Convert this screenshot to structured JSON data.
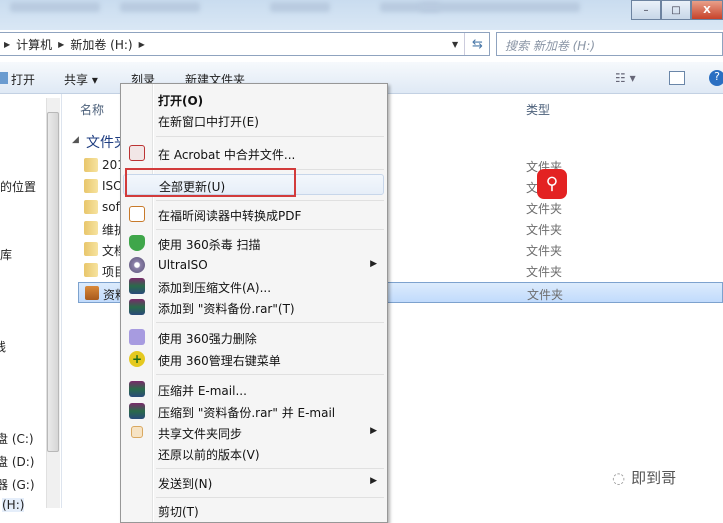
{
  "window": {
    "minimize": "–",
    "maximize": "□",
    "close": "X"
  },
  "address": {
    "crumbs": [
      "计算机",
      "新加卷 (H:)"
    ]
  },
  "search": {
    "placeholder": "搜索 新加卷 (H:)"
  },
  "toolbar": {
    "open": "打开",
    "share": "共享 ▾",
    "burn": "刻录",
    "new_folder": "新建文件夹"
  },
  "nav": {
    "items": [
      "的位置",
      "库",
      "线",
      "盘 (C:)",
      "盘 (D:)",
      "器 (G:)",
      "(H:)"
    ]
  },
  "columns": {
    "name": "名称",
    "type": "类型"
  },
  "group": "文件夹",
  "files": [
    {
      "name": "201",
      "type": "文件夹"
    },
    {
      "name": "ISO",
      "type": "文件夹"
    },
    {
      "name": "sof",
      "type": "文件夹"
    },
    {
      "name": "维护",
      "type": "文件夹"
    },
    {
      "name": "文档",
      "type": "文件夹"
    },
    {
      "name": "项目",
      "type": "文件夹"
    },
    {
      "name": "资料",
      "type": "文件夹"
    }
  ],
  "menu": {
    "open": "打开(O)",
    "open_new": "在新窗口中打开(E)",
    "acrobat": "在 Acrobat 中合并文件...",
    "update_all": "全部更新(U)",
    "foxit": "在福昕阅读器中转换成PDF",
    "scan360": "使用 360杀毒 扫描",
    "ultraiso": "UltraISO",
    "add_archive": "添加到压缩文件(A)...",
    "add_rar": "添加到 \"资料备份.rar\"(T)",
    "del360": "使用 360强力删除",
    "manage360": "使用 360管理右键菜单",
    "zip_email": "压缩并 E-mail...",
    "rar_email": "压缩到 \"资料备份.rar\" 并 E-mail",
    "share_sync": "共享文件夹同步",
    "restore": "还原以前的版本(V)",
    "send_to": "发送到(N)",
    "cut": "剪切(T)"
  },
  "watermark": "即到哥"
}
